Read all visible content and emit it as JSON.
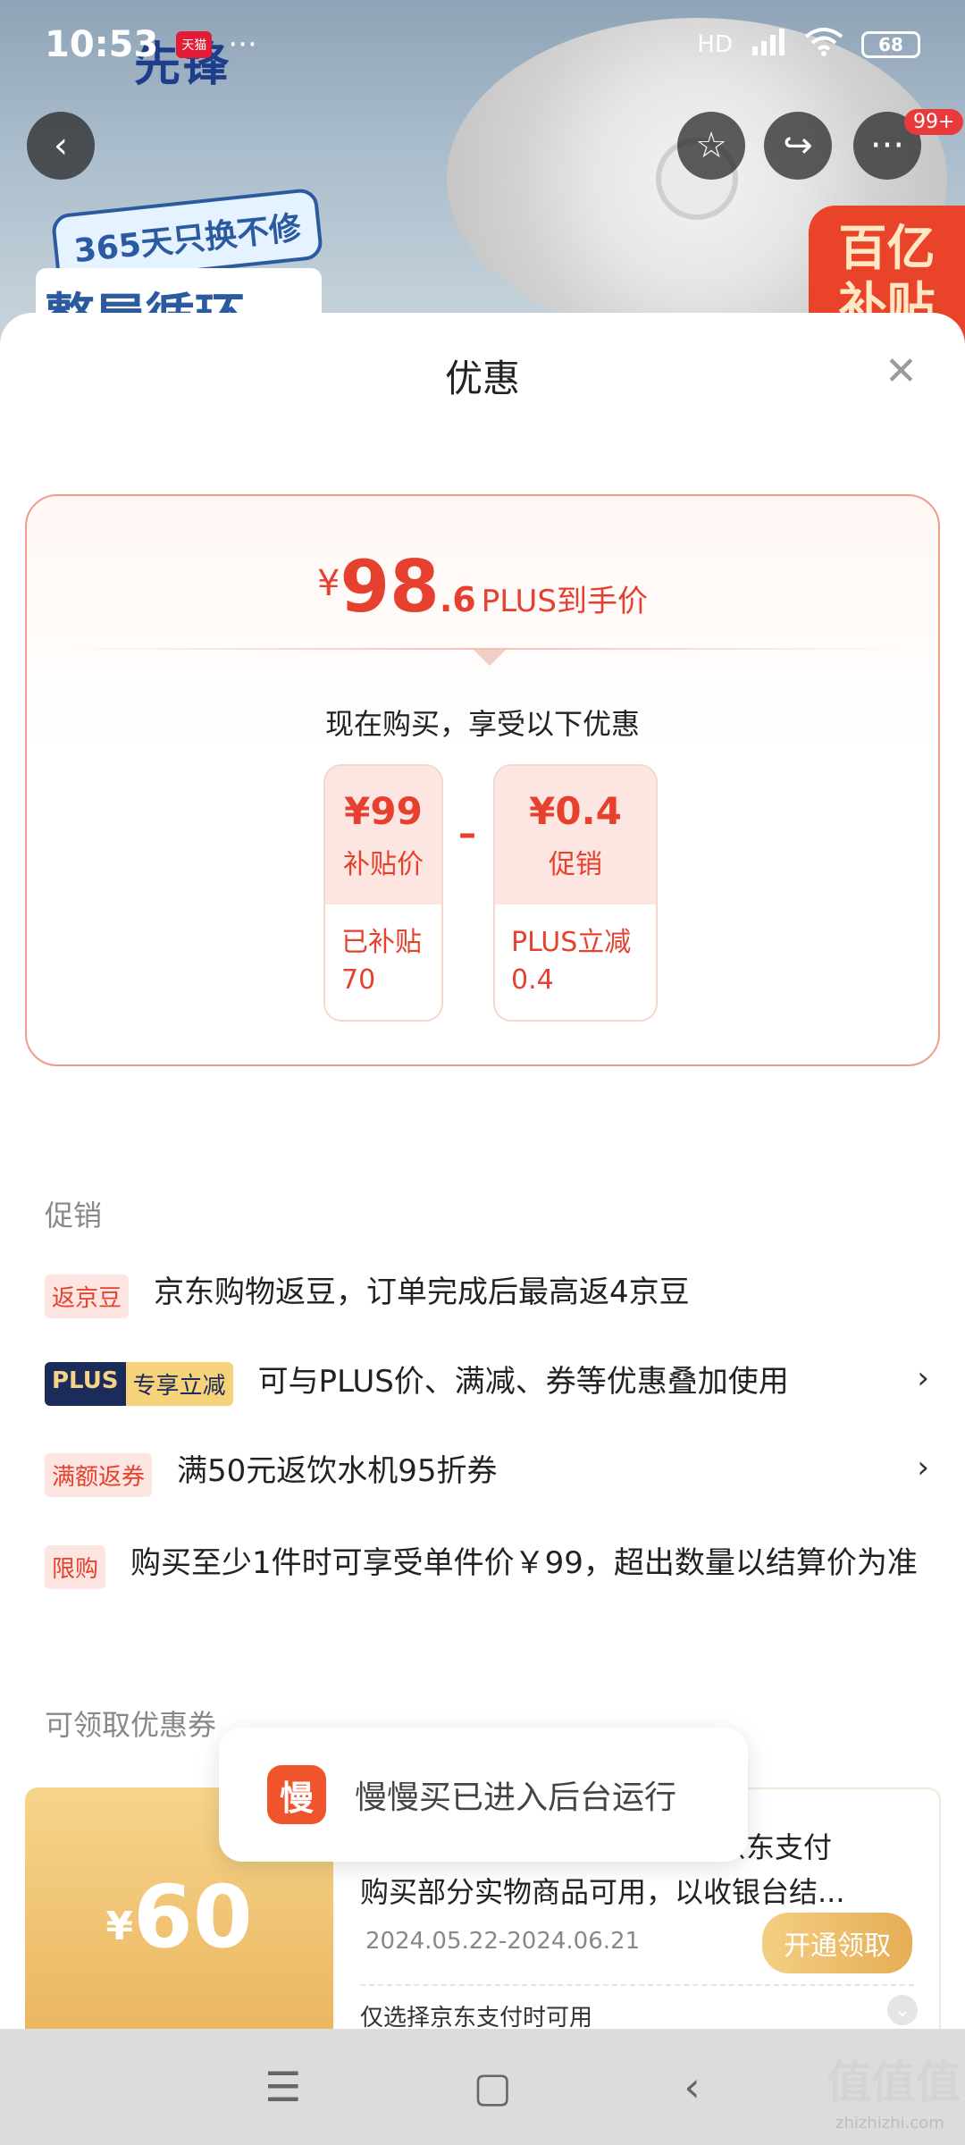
{
  "status_bar": {
    "time": "10:53",
    "app_badge": "天猫",
    "dots": "···",
    "network": "HD",
    "battery": "68"
  },
  "hero": {
    "brand": "先锋",
    "badge_line1": "365天只换不修",
    "badge_line2": "整屋循环",
    "subsidy_line1": "百亿",
    "subsidy_line2": "补贴"
  },
  "top_actions": {
    "back_icon": "‹",
    "favorite_icon": "☆",
    "share_icon": "↪",
    "more_icon": "···",
    "message_count": "99+"
  },
  "sheet": {
    "title": "优惠",
    "close_icon": "✕",
    "price_card": {
      "yen": "¥",
      "price_int": "98",
      "price_dec": ".6",
      "price_label": "PLUS到手价",
      "buy_note": "现在购买，享受以下优惠",
      "subsidy_box": {
        "amount": "¥99",
        "label": "补贴价",
        "detail": "已补贴70"
      },
      "minus": "–",
      "promo_box": {
        "amount": "¥0.4",
        "label": "促销",
        "detail": "PLUS立减0.4"
      }
    },
    "promotions": {
      "title": "促销",
      "items": [
        {
          "tag": "返京豆",
          "text": "京东购物返豆，订单完成后最高返4京豆",
          "chevron": ""
        },
        {
          "tag_a": "PLUS",
          "tag_b": "专享立减",
          "text": "可与PLUS价、满减、券等优惠叠加使用",
          "chevron": "›"
        },
        {
          "tag": "满额返券",
          "text": "满50元返饮水机95折券",
          "chevron": "›"
        },
        {
          "tag": "限购",
          "text": "购买至少1件时可享受单件价￥99，超出数量以结算价为准",
          "chevron": ""
        }
      ]
    },
    "coupons": {
      "title": "可领取优惠券",
      "item": {
        "yen": "¥",
        "amount": "60",
        "line1": "京东支付",
        "line2": "购买部分实物商品可用，以收银台结...",
        "date": "2024.05.22-2024.06.21",
        "button": "开通领取",
        "note": "仅选择京东支付时可用",
        "expand_icon": "⌄"
      }
    }
  },
  "toast": {
    "icon_text": "慢",
    "message": "慢慢买已进入后台运行"
  },
  "navbar": {
    "menu_icon": "☰",
    "home_icon": "▢",
    "back_icon": "‹"
  },
  "watermark": {
    "main": "值值值",
    "sub": "zhizhizhi.com"
  }
}
